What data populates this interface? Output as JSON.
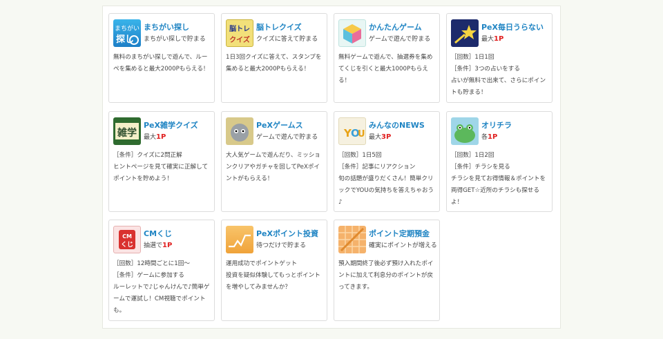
{
  "cards": [
    {
      "title": "まちがい探し",
      "subtitle": "まちがい探しで貯まる",
      "icon_text": "まちがい 探し",
      "lines": [
        "無料のまちがい探しで遊んで、ルーペを集めると最大2000Pもらえる！"
      ]
    },
    {
      "title": "脳トレクイズ",
      "subtitle": "クイズに答えて貯まる",
      "icon_text": "脳トレ クイズ",
      "lines": [
        "1日3回クイズに答えて、スタンプを集めると最大2000Pもらえる！"
      ]
    },
    {
      "title": "かんたんゲーム",
      "subtitle": "ゲームで遊んで貯まる",
      "icon_text": "ゲーム",
      "lines": [
        "無料ゲームで遊んで、抽選券を集めてくじを引くと最大1000Pもらえる！"
      ]
    },
    {
      "title": "PeX毎日うらない",
      "subtitle_prefix": "最大",
      "subtitle_points": "1P",
      "icon_text": "star",
      "lines": [
        "［回数］1日1回",
        "［条件］3つの占いをする",
        "占いが無料で出来て、さらにポイントも貯まる！"
      ]
    },
    {
      "title": "PeX雑学クイズ",
      "subtitle_prefix": "最大",
      "subtitle_points": "1P",
      "icon_text": "雑学",
      "lines": [
        "［条件］クイズに2問正解",
        "ヒントページを見て確実に正解してポイントを貯めよう！"
      ]
    },
    {
      "title": "PeXゲームス",
      "subtitle": "ゲームで遊んで貯まる",
      "icon_text": "ghost",
      "lines": [
        "大人気ゲームで遊んだり、ミッションクリアやガチャを回してPeXポイントがもらえる！"
      ]
    },
    {
      "title": "みんなのNEWS",
      "subtitle_prefix": "最大",
      "subtitle_points": "3P",
      "icon_text": "YOU",
      "lines": [
        "［回数］1日5回",
        "［条件］記事にリアクション",
        "旬の話題が盛りだくさん！簡単クリックでYOUの気持ちを答えちゃおう♪"
      ]
    },
    {
      "title": "オリチラ",
      "subtitle_prefix": "各",
      "subtitle_points": "1P",
      "icon_text": "frog",
      "lines": [
        "［回数］1日2回",
        "［条件］チラシを見る",
        "チラシを見てお得情報＆ポイントを両得GET☆近所のチラシも探せるよ！"
      ]
    },
    {
      "title": "CMくじ",
      "subtitle_prefix": "抽選で",
      "subtitle_points": "1P",
      "icon_text": "CMくじ",
      "lines": [
        "［回数］12時間ごとに1回～",
        "［条件］ゲームに参加する",
        "ルーレットで♪じゃんけんで♪簡単ゲームで運試し！CM視聴でポイントも。"
      ]
    },
    {
      "title": "PeXポイント投資",
      "subtitle": "待つだけで貯まる",
      "icon_text": "chart",
      "lines": [
        "運用成功でポイントゲット",
        "投資を疑似体験してもっとポイントを増やしてみませんか？"
      ]
    },
    {
      "title": "ポイント定期預金",
      "subtitle": "確実にポイントが増える",
      "icon_text": "grid",
      "lines": [
        "預入期間終了後必ず預け入れたポイントに加えて利息分のポイントが戻ってきます。"
      ]
    }
  ]
}
